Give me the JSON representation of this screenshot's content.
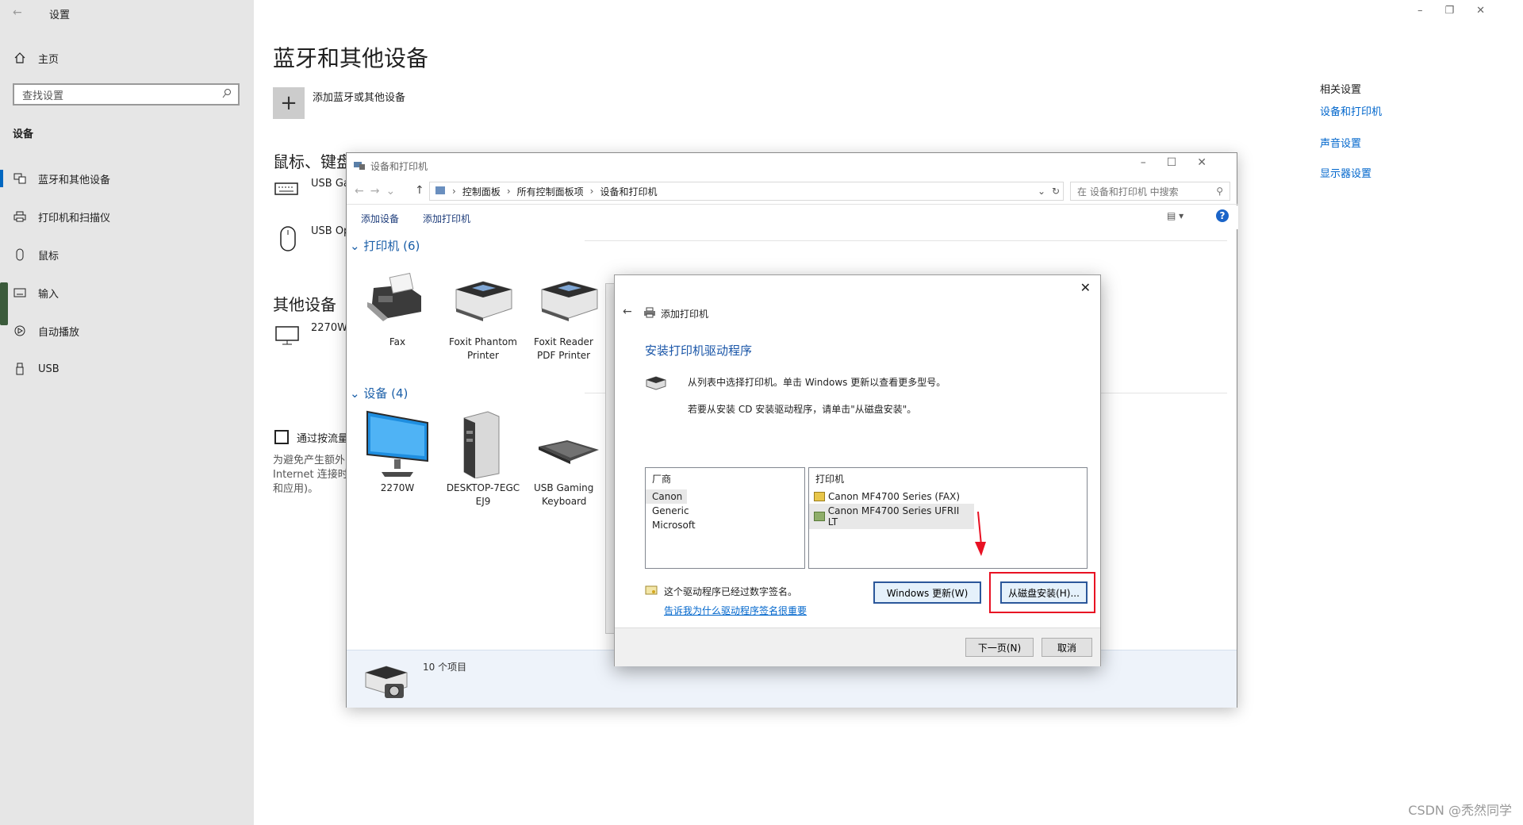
{
  "settings": {
    "title": "设置",
    "home": "主页",
    "search_placeholder": "查找设置",
    "section": "设备",
    "nav": [
      {
        "label": "蓝牙和其他设备",
        "icon": "bluetooth-devices-icon"
      },
      {
        "label": "打印机和扫描仪",
        "icon": "printer-icon"
      },
      {
        "label": "鼠标",
        "icon": "mouse-icon"
      },
      {
        "label": "输入",
        "icon": "keyboard-icon"
      },
      {
        "label": "自动播放",
        "icon": "autoplay-icon"
      },
      {
        "label": "USB",
        "icon": "usb-icon"
      }
    ],
    "page_title": "蓝牙和其他设备",
    "add_device": "添加蓝牙或其他设备",
    "mouse_section": "鼠标、键盘和笔",
    "usb_gaming": "USB Ga",
    "usb_optical": "USB Op",
    "other_section": "其他设备",
    "other_monitor": "2270W",
    "metered_label": "通过按流量",
    "metered_desc_1": "为避免产生额外",
    "metered_desc_2": "Internet 连接时",
    "metered_desc_3": "和应用)。",
    "related_title": "相关设置",
    "related_links": [
      "设备和打印机",
      "声音设置",
      "显示器设置"
    ]
  },
  "dp_window": {
    "title": "设备和打印机",
    "breadcrumb": [
      "控制面板",
      "所有控制面板项",
      "设备和打印机"
    ],
    "search_placeholder": "在 设备和打印机 中搜索",
    "cmd_add_device": "添加设备",
    "cmd_add_printer": "添加打印机",
    "printers_header": "打印机 (6)",
    "printers": [
      {
        "line1": "Fax",
        "line2": ""
      },
      {
        "line1": "Foxit Phantom",
        "line2": "Printer"
      },
      {
        "line1": "Foxit Reader",
        "line2": "PDF Printer"
      }
    ],
    "devices_header": "设备 (4)",
    "devices": [
      {
        "line1": "2270W",
        "line2": ""
      },
      {
        "line1": "DESKTOP-7EGC",
        "line2": "EJ9"
      },
      {
        "line1": "USB Gaming",
        "line2": "Keyboard"
      }
    ],
    "status_count": "10 个项目"
  },
  "dialog": {
    "title": "添加打印机",
    "heading": "安装打印机驱动程序",
    "desc1": "从列表中选择打印机。单击 Windows 更新以查看更多型号。",
    "desc2": "若要从安装 CD 安装驱动程序，请单击\"从磁盘安装\"。",
    "vendor_header": "厂商",
    "vendors": [
      "Canon",
      "Generic",
      "Microsoft"
    ],
    "printer_header": "打印机",
    "printers": [
      "Canon MF4700 Series (FAX)",
      "Canon MF4700 Series UFRII LT"
    ],
    "signed_text": "这个驱动程序已经过数字签名。",
    "signed_link": "告诉我为什么驱动程序签名很重要",
    "windows_update_btn": "Windows 更新(W)",
    "from_disk_btn": "从磁盘安装(H)...",
    "next_btn": "下一页(N)",
    "cancel_btn": "取消"
  },
  "watermark": "CSDN @秃然同学",
  "colors": {
    "accent": "#0067c0",
    "highlight_red": "#e81123"
  }
}
